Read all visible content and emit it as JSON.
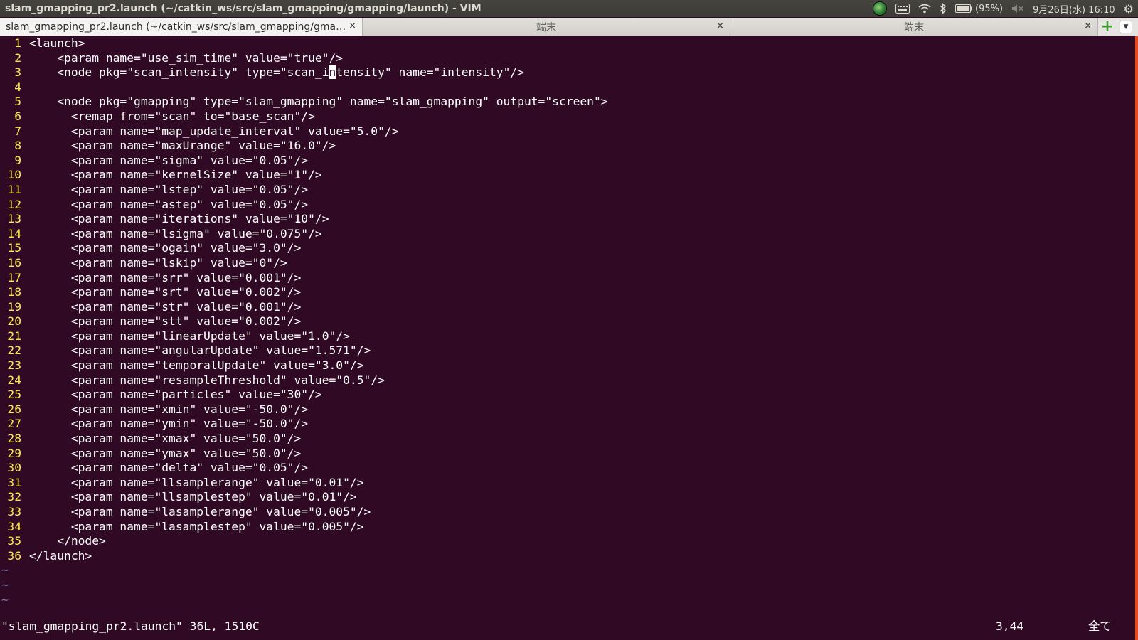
{
  "window": {
    "title": "slam_gmapping_pr2.launch (~/catkin_ws/src/slam_gmapping/gmapping/launch) - VIM"
  },
  "indicators": {
    "keyboard_icon": "keyboard-icon",
    "battery_text": "(95%)",
    "datetime": "9月26日(水) 16:10"
  },
  "tabs": [
    {
      "label": "slam_gmapping_pr2.launch (~/catkin_ws/src/slam_gmapping/gmap…",
      "close": "×"
    },
    {
      "label": "端末",
      "close": "×"
    },
    {
      "label": "端末",
      "close": "×"
    }
  ],
  "editor": {
    "lines": [
      {
        "n": "1",
        "text": "<launch>"
      },
      {
        "n": "2",
        "text": "    <param name=\"use_sim_time\" value=\"true\"/>"
      },
      {
        "n": "3",
        "pre": "    <node pkg=\"scan_intensity\" type=\"scan_i",
        "cursor": "n",
        "post": "tensity\" name=\"intensity\"/>"
      },
      {
        "n": "4",
        "text": ""
      },
      {
        "n": "5",
        "text": "    <node pkg=\"gmapping\" type=\"slam_gmapping\" name=\"slam_gmapping\" output=\"screen\">"
      },
      {
        "n": "6",
        "text": "      <remap from=\"scan\" to=\"base_scan\"/>"
      },
      {
        "n": "7",
        "text": "      <param name=\"map_update_interval\" value=\"5.0\"/>"
      },
      {
        "n": "8",
        "text": "      <param name=\"maxUrange\" value=\"16.0\"/>"
      },
      {
        "n": "9",
        "text": "      <param name=\"sigma\" value=\"0.05\"/>"
      },
      {
        "n": "10",
        "text": "      <param name=\"kernelSize\" value=\"1\"/>"
      },
      {
        "n": "11",
        "text": "      <param name=\"lstep\" value=\"0.05\"/>"
      },
      {
        "n": "12",
        "text": "      <param name=\"astep\" value=\"0.05\"/>"
      },
      {
        "n": "13",
        "text": "      <param name=\"iterations\" value=\"10\"/>"
      },
      {
        "n": "14",
        "text": "      <param name=\"lsigma\" value=\"0.075\"/>"
      },
      {
        "n": "15",
        "text": "      <param name=\"ogain\" value=\"3.0\"/>"
      },
      {
        "n": "16",
        "text": "      <param name=\"lskip\" value=\"0\"/>"
      },
      {
        "n": "17",
        "text": "      <param name=\"srr\" value=\"0.001\"/>"
      },
      {
        "n": "18",
        "text": "      <param name=\"srt\" value=\"0.002\"/>"
      },
      {
        "n": "19",
        "text": "      <param name=\"str\" value=\"0.001\"/>"
      },
      {
        "n": "20",
        "text": "      <param name=\"stt\" value=\"0.002\"/>"
      },
      {
        "n": "21",
        "text": "      <param name=\"linearUpdate\" value=\"1.0\"/>"
      },
      {
        "n": "22",
        "text": "      <param name=\"angularUpdate\" value=\"1.571\"/>"
      },
      {
        "n": "23",
        "text": "      <param name=\"temporalUpdate\" value=\"3.0\"/>"
      },
      {
        "n": "24",
        "text": "      <param name=\"resampleThreshold\" value=\"0.5\"/>"
      },
      {
        "n": "25",
        "text": "      <param name=\"particles\" value=\"30\"/>"
      },
      {
        "n": "26",
        "text": "      <param name=\"xmin\" value=\"-50.0\"/>"
      },
      {
        "n": "27",
        "text": "      <param name=\"ymin\" value=\"-50.0\"/>"
      },
      {
        "n": "28",
        "text": "      <param name=\"xmax\" value=\"50.0\"/>"
      },
      {
        "n": "29",
        "text": "      <param name=\"ymax\" value=\"50.0\"/>"
      },
      {
        "n": "30",
        "text": "      <param name=\"delta\" value=\"0.05\"/>"
      },
      {
        "n": "31",
        "text": "      <param name=\"llsamplerange\" value=\"0.01\"/>"
      },
      {
        "n": "32",
        "text": "      <param name=\"llsamplestep\" value=\"0.01\"/>"
      },
      {
        "n": "33",
        "text": "      <param name=\"lasamplerange\" value=\"0.005\"/>"
      },
      {
        "n": "34",
        "text": "      <param name=\"lasamplestep\" value=\"0.005\"/>"
      },
      {
        "n": "35",
        "text": "    </node>"
      },
      {
        "n": "36",
        "text": "</launch>"
      }
    ],
    "tildes": [
      "~",
      "~",
      "~"
    ]
  },
  "status": {
    "file_info": "\"slam_gmapping_pr2.launch\" 36L, 1510C",
    "cursor_pos": "3,44",
    "scroll_pos": "全て"
  }
}
